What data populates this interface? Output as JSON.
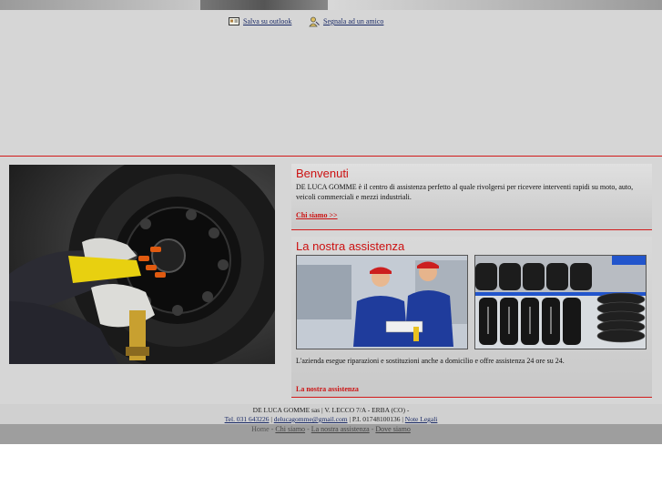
{
  "header": {
    "save_outlook": "Salva su outlook",
    "tell_friend": "Segnala ad un amico"
  },
  "welcome": {
    "title": "Benvenuti",
    "text": "DE LUCA GOMME è il centro di assistenza perfetto al quale rivolgersi per ricevere interventi rapidi su moto, auto, veicoli commerciali e mezzi industriali.",
    "link": "Chi siamo >>"
  },
  "assistance": {
    "title": "La nostra assistenza",
    "text": "L'azienda esegue riparazioni e sostituzioni anche a domicilio e offre assistenza 24 ore su 24.",
    "link": "La nostra assistenza"
  },
  "footer": {
    "line1": "DE LUCA GOMME sas | V. LECCO 7/A - ERBA (CO) -",
    "tel": "Tel. 031 643226",
    "sep1": " | ",
    "email": "delucagomme@gmail.com",
    "piva": " | P.I. 01748100136 | ",
    "legal": "Note Legali"
  },
  "nav": {
    "home": "Home",
    "sep": " - ",
    "chi_siamo": "Chi siamo",
    "assistenza": "La nostra assistenza",
    "dove": "Dove siamo"
  },
  "colors": {
    "accent_red": "#cc1111",
    "link_blue": "#1a2a66",
    "panel_gray": "#d6d6d6"
  }
}
